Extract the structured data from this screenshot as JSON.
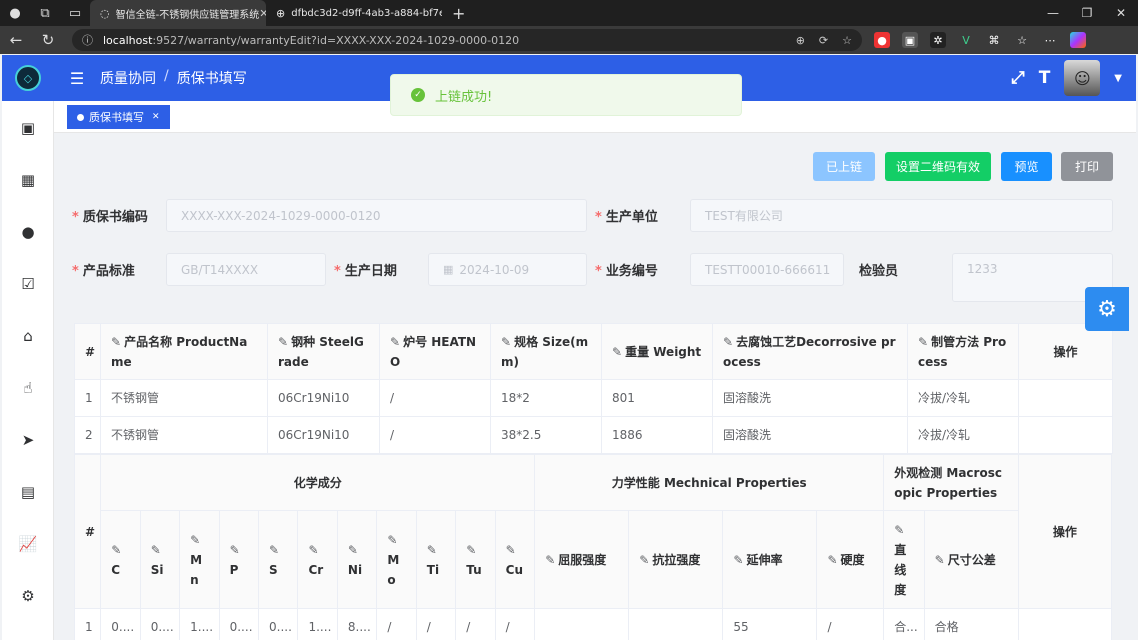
{
  "browser": {
    "tabs": [
      {
        "title": "智信全链-不锈钢供应链管理系统"
      },
      {
        "title": "dfbdc3d2-d9ff-4ab3-a884-bf7ec"
      }
    ],
    "url_host": "localhost",
    "url_rest": ":9527/warranty/warrantyEdit?id=XXXX-XXX-2024-1029-0000-0120"
  },
  "topbar": {
    "breadcrumb": [
      "质量协同",
      "质保书填写"
    ]
  },
  "tagsbar": {
    "tag": "质保书填写"
  },
  "toast": {
    "message": "上链成功!"
  },
  "actions": {
    "chained": "已上链",
    "qrcode": "设置二维码有效",
    "preview": "预览",
    "print": "打印"
  },
  "colors": {
    "primary": "#2d5fe6",
    "green": "#13ce66",
    "blue": "#1890ff",
    "gray": "#909399",
    "disabled": "#8cc5ff"
  },
  "form": {
    "cert_no_label": "质保书编码",
    "cert_no": "XXXX-XXX-2024-1029-0000-0120",
    "producer_label": "生产单位",
    "producer": "TEST有限公司",
    "standard_label": "产品标准",
    "standard": "GB/T14XXXX",
    "date_label": "生产日期",
    "date": "2024-10-09",
    "biz_no_label": "业务编号",
    "biz_no": "TESTT00010-666611",
    "inspector_label": "检验员",
    "inspector": "1233"
  },
  "product_table": {
    "headers": [
      "#",
      "产品名称 ProductName",
      "钢种 SteelGrade",
      "炉号 HEATNO",
      "规格 Size(mm)",
      "重量 Weight",
      "去腐蚀工艺Decorrosive process",
      "制管方法 Process",
      "操作"
    ],
    "rows": [
      [
        "1",
        "不锈钢管",
        "06Cr19Ni10",
        "/",
        "18*2",
        "801",
        "固溶酸洗",
        "冷拔/冷轧",
        ""
      ],
      [
        "2",
        "不锈钢管",
        "06Cr19Ni10",
        "/",
        "38*2.5",
        "1886",
        "固溶酸洗",
        "冷拔/冷轧",
        ""
      ]
    ]
  },
  "props_table": {
    "index_header": "#",
    "group_chem": "化学成分",
    "group_mech": "力学性能 Mechnical Properties",
    "group_macro": "外观检测 Macroscopic Properties",
    "op_header": "操作",
    "chem_cols": [
      "C",
      "Si",
      "Mn",
      "P",
      "S",
      "Cr",
      "Ni",
      "Mo",
      "Ti",
      "Tu",
      "Cu"
    ],
    "mech_cols": [
      "屈服强度",
      "抗拉强度",
      "延伸率",
      "硬度"
    ],
    "macro_cols": [
      "直线度",
      "尺寸公差"
    ],
    "row": [
      "1",
      "0....",
      "0....",
      "1....",
      "0....",
      "0....",
      "1....",
      "8....",
      "/",
      "/",
      "/",
      "/",
      "",
      "",
      "55",
      "/",
      "合...",
      "合格",
      ""
    ]
  }
}
